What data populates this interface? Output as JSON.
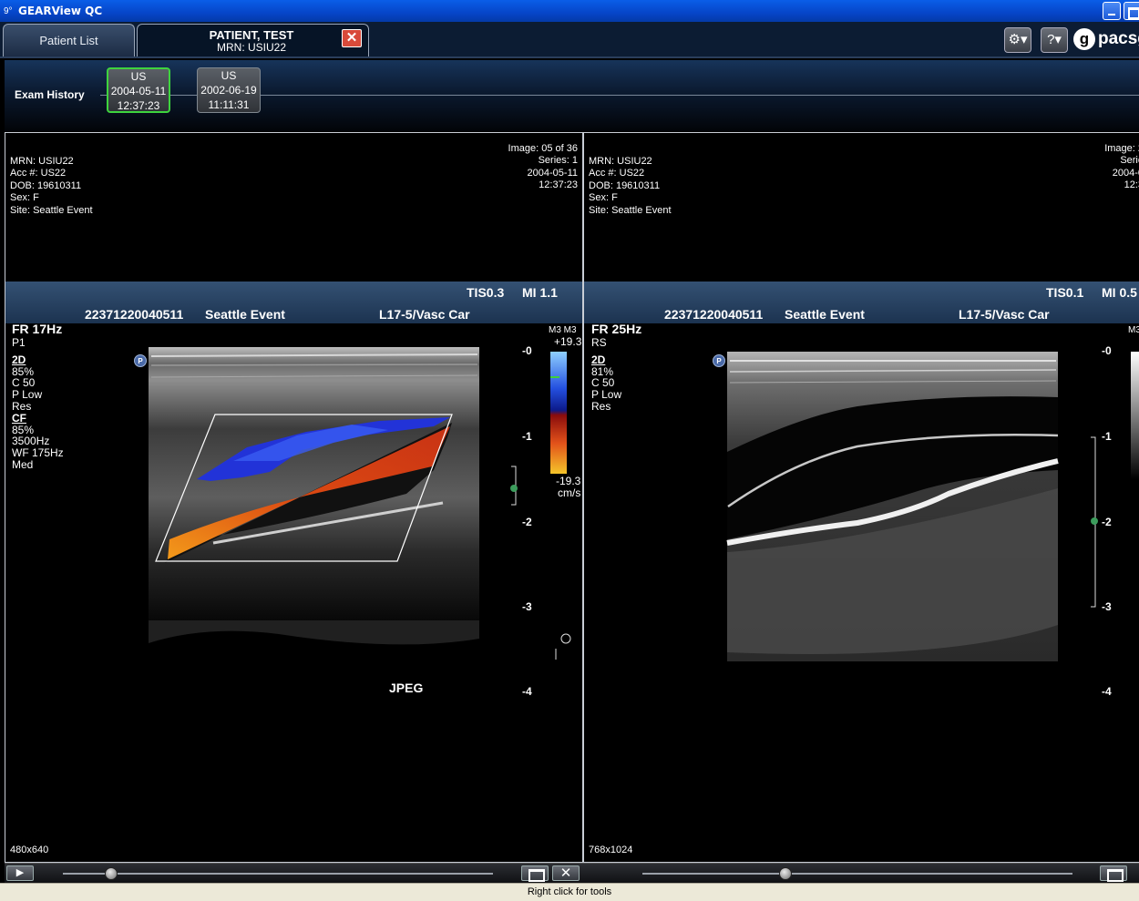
{
  "window": {
    "title": "GEARView QC",
    "app_icon": "9°"
  },
  "tabs": {
    "patient_list_label": "Patient List",
    "patient_name": "PATIENT, TEST",
    "patient_mrn": "MRN: USIU22",
    "close_glyph": "✕"
  },
  "toolbar": {
    "settings_icon": "gear-icon",
    "help_icon": "help-icon",
    "brand_letter": "g",
    "brand_text": "pacsgear"
  },
  "exam_history": {
    "label": "Exam History",
    "exams": [
      {
        "modality": "US",
        "date": "2004-05-11",
        "time": "12:37:23",
        "selected": true
      },
      {
        "modality": "US",
        "date": "2002-06-19",
        "time": "11:11:31",
        "selected": false
      }
    ]
  },
  "viewports": [
    {
      "patient": [
        "MRN: USIU22",
        "Acc #: US22",
        "DOB: 19610311",
        "Sex: F",
        "Site: Seattle Event"
      ],
      "image_info": [
        "Image: 05 of 36",
        "Series: 1",
        "2004-05-11",
        "12:37:23"
      ],
      "band": {
        "tis": "TIS0.3",
        "mi": "MI 1.1",
        "id": "22371220040511",
        "site": "Seattle Event",
        "probe": "L17-5/Vasc Car"
      },
      "fr": "FR 17Hz",
      "params": [
        "P1",
        "2D",
        " 85%",
        "C 50",
        "P Low",
        "Res",
        "CF",
        " 85%",
        " 3500Hz",
        "WF 175Hz",
        "Med"
      ],
      "ruler": [
        "-0",
        "-1",
        "-2",
        "-3",
        "-4"
      ],
      "color_scale": {
        "top_label": "M3 M3",
        "max": "+19.3",
        "min": "-19.3",
        "unit": "cm/s"
      },
      "overlay_text": "JPEG",
      "dims": "480x640",
      "p_marker": "P"
    },
    {
      "patient": [
        "MRN: USIU22",
        "Acc #: US22",
        "DOB: 19610311",
        "Sex: F",
        "Site: Seattle Event"
      ],
      "image_info": [
        "Image: 2",
        "Serie",
        "2004-0",
        "12:3"
      ],
      "band": {
        "tis": "TIS0.1",
        "mi": "MI 0.5",
        "id": "22371220040511",
        "site": "Seattle Event",
        "probe": "L17-5/Vasc Car"
      },
      "fr": "FR 25Hz",
      "params": [
        "RS",
        "2D",
        " 81%",
        "C 50",
        "P Low",
        "Res"
      ],
      "ruler": [
        "-0",
        "-1",
        "-2",
        "-3",
        "-4"
      ],
      "color_scale": {
        "top_label": "M3"
      },
      "dims": "768x1024",
      "p_marker": "P"
    }
  ],
  "controls": {
    "play_glyph": "▶",
    "close_glyph": "✕"
  },
  "status": {
    "text": "Right click for tools"
  },
  "colors": {
    "title_blue": "#0645c8",
    "selected_exam_border": "#3ed43e",
    "close_red": "#d84a3a"
  }
}
